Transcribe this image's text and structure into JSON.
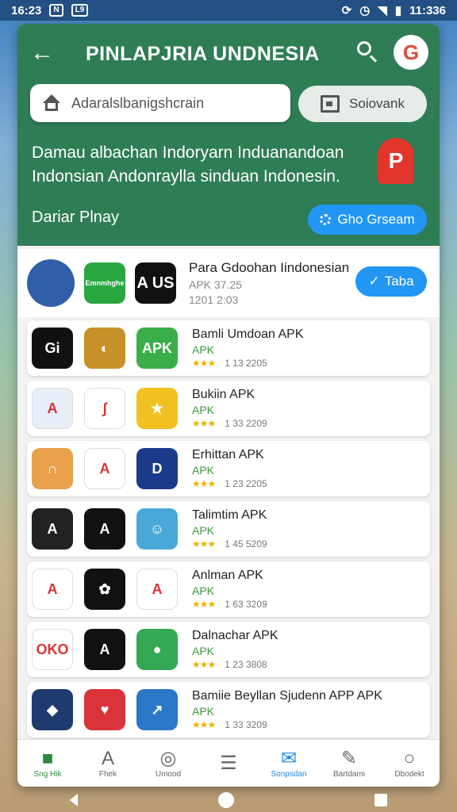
{
  "status_bar": {
    "time": "16:23",
    "notif": "L9",
    "battery_time": "11:336"
  },
  "header": {
    "title": "PINLAPJRIA UNDNESIA",
    "search_placeholder": "Adaralslbanigshcrain",
    "secondary_button": "Soiovank",
    "headline": "Damau albachan Indoryarn Induanandoan Indonsian Andonraylla sinduan Indonesin.",
    "section_label": "Dariar Plnay",
    "cta_button": "Gho Grseam",
    "avatar_letter": "G",
    "promo_letter": "P"
  },
  "featured": {
    "name": "Para Gdoohan Iindonesian",
    "tag": "APK 37.25",
    "date": "1201 2:03",
    "button": "Taba",
    "icons": [
      {
        "label": "",
        "bg": "#2e5fa8"
      },
      {
        "label": "Emnmhghe",
        "bg": "#2aa640"
      },
      {
        "label": "A US",
        "bg": "#111111"
      }
    ]
  },
  "apps": [
    {
      "name": "Bamli Umdoan APK",
      "apk": "APK",
      "meta": "1 13 2205",
      "icons": [
        {
          "label": "Gi",
          "bg": "#111111"
        },
        {
          "label": "◐",
          "bg": "#c7912a"
        },
        {
          "label": "APK",
          "bg": "#3aae48"
        }
      ]
    },
    {
      "name": "Bukiin APK",
      "apk": "APK",
      "meta": "1 33 2209",
      "icons": [
        {
          "label": "A",
          "bg": "#e8eef8"
        },
        {
          "label": "ʃ",
          "bg": "#ffffff"
        },
        {
          "label": "★",
          "bg": "#f2c020"
        }
      ]
    },
    {
      "name": "Erhittan APK",
      "apk": "APK",
      "meta": "1 23 2205",
      "icons": [
        {
          "label": "∩",
          "bg": "#e8a04a"
        },
        {
          "label": "A",
          "bg": "#ffffff"
        },
        {
          "label": "D",
          "bg": "#1b3b8a"
        }
      ]
    },
    {
      "name": "Talimtim APK",
      "apk": "APK",
      "meta": "1 45 5209",
      "icons": [
        {
          "label": "A",
          "bg": "#222222"
        },
        {
          "label": "A",
          "bg": "#111111"
        },
        {
          "label": "☺",
          "bg": "#4aa8d8"
        }
      ]
    },
    {
      "name": "Anlman APK",
      "apk": "APK",
      "meta": "1 63 3209",
      "icons": [
        {
          "label": "A",
          "bg": "#ffffff"
        },
        {
          "label": "✿",
          "bg": "#111111"
        },
        {
          "label": "A",
          "bg": "#ffffff"
        }
      ]
    },
    {
      "name": "Dalnachar APK",
      "apk": "APK",
      "meta": "1 23 3808",
      "icons": [
        {
          "label": "OKO",
          "bg": "#ffffff"
        },
        {
          "label": "A",
          "bg": "#111111"
        },
        {
          "label": "●",
          "bg": "#34a853"
        }
      ]
    },
    {
      "name": "Bamiie Beyllan Sjudenn APP APK",
      "apk": "APK",
      "meta": "1 33 3209",
      "icons": [
        {
          "label": "◆",
          "bg": "#1e3a6e"
        },
        {
          "label": "♥",
          "bg": "#d9343a"
        },
        {
          "label": "↗",
          "bg": "#2c78c8"
        }
      ]
    }
  ],
  "bottom_nav": [
    {
      "label": "Sng Hik",
      "glyph": "■"
    },
    {
      "label": "Fhek",
      "glyph": "A"
    },
    {
      "label": "Umood",
      "glyph": "◎"
    },
    {
      "label": "",
      "glyph": "☰"
    },
    {
      "label": "Sonpsdan",
      "glyph": "✉"
    },
    {
      "label": "Bartdami",
      "glyph": "✎"
    },
    {
      "label": "Dbodekt",
      "glyph": "○"
    }
  ],
  "colors": {
    "header_bg": "#2e7d55",
    "accent_blue": "#2196f3",
    "apk_green": "#3a9a3a",
    "star": "#e8b400"
  },
  "stars": "★★★"
}
